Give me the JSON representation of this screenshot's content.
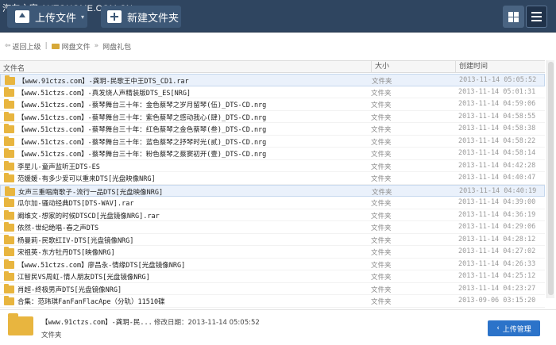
{
  "watermark": "汽车之家  AUTOHOME.COM.CN",
  "toolbar": {
    "upload_label": "上传文件",
    "upload_caret": "▾",
    "newfolder_label": "新建文件夹"
  },
  "breadcrumb": {
    "back_label": "返回上级",
    "path_root": "网盘文件",
    "separator": "»",
    "path_current": "网盘礼包"
  },
  "columns": {
    "name": "文件名",
    "size": "大小",
    "created": "创建时间"
  },
  "rows": [
    {
      "name": "【www.91ctzs.com】-龚玥-民歌王中王DTS_CD1.rar",
      "type": "文件夹",
      "date": "2013-11-14  05:05:52"
    },
    {
      "name": "【www.51ctzs.com】-真发烧人声精装版DTS_ES[NRG]",
      "type": "文件夹",
      "date": "2013-11-14  05:01:31"
    },
    {
      "name": "【www.51ctzs.com】-蔡琴舞台三十年：金色蔡琴之岁月留琴(伍)_DTS-CD.nrg",
      "type": "文件夹",
      "date": "2013-11-14  04:59:06"
    },
    {
      "name": "【www.51ctzs.com】-蔡琴舞台三十年：紫色蔡琴之感动我心(肆)_DTS-CD.nrg",
      "type": "文件夹",
      "date": "2013-11-14  04:58:55"
    },
    {
      "name": "【www.51ctzs.com】-蔡琴舞台三十年：红色蔡琴之金色蔡琴(叁)_DTS-CD.nrg",
      "type": "文件夹",
      "date": "2013-11-14  04:58:38"
    },
    {
      "name": "【www.51ctzs.com】-蔡琴舞台三十年：蓝色蔡琴之抒琴时光(贰)_DTS-CD.nrg",
      "type": "文件夹",
      "date": "2013-11-14  04:58:22"
    },
    {
      "name": "【www.51ctzs.com】-蔡琴舞台三十年：粉色蔡琴之蔡窦初开(壹)_DTS-CD.nrg",
      "type": "文件夹",
      "date": "2013-11-14  04:58:14"
    },
    {
      "name": "李星儿-童声监听王DTS-ES",
      "type": "文件夹",
      "date": "2013-11-14  04:42:28"
    },
    {
      "name": "范媛媛-有多少爱可以重来DTS[光盘映像NRG]",
      "type": "文件夹",
      "date": "2013-11-14  04:40:47"
    },
    {
      "name": "女声三重唱南歌子-流行一品DTS[光盘映像NRG]",
      "type": "文件夹",
      "date": "2013-11-14  04:40:19"
    },
    {
      "name": "瓜尔加-骚动经典DTS[DTS-WAV].rar",
      "type": "文件夹",
      "date": "2013-11-14  04:39:00"
    },
    {
      "name": "阚维文-想家的时候DTSCD[光盘镜像NRG].rar",
      "type": "文件夹",
      "date": "2013-11-14  04:36:19"
    },
    {
      "name": "依然-世纪绝唱-春之声DTS",
      "type": "文件夹",
      "date": "2013-11-14  04:29:06"
    },
    {
      "name": "杨曼莉-民歌红IV-DTS[光盘镜像NRG]",
      "type": "文件夹",
      "date": "2013-11-14  04:28:12"
    },
    {
      "name": "宋祖英-东方牡丹DTS[映像NRG]",
      "type": "文件夹",
      "date": "2013-11-14  04:27:02"
    },
    {
      "name": "【www.51ctzs.com】廖昌永-情缘DTS[光盘镜像NRG]",
      "type": "文件夹",
      "date": "2013-11-14  04:26:33"
    },
    {
      "name": "江智民VS周虹-情人朋友DTS[光盘镜像NRG]",
      "type": "文件夹",
      "date": "2013-11-14  04:25:12"
    },
    {
      "name": "肖超-终极男声DTS[光盘镜像NRG]",
      "type": "文件夹",
      "date": "2013-11-14  04:23:27"
    },
    {
      "name": "合集：范玮琪FanFanFlacApe（分轨）11510碟",
      "type": "文件夹",
      "date": "2013-09-06  03:15:20"
    }
  ],
  "footer": {
    "selected_name": "【www.91ctzs.com】-龚玥-民...",
    "modified_label": "修改日期：2013-11-14  05:05:52",
    "selected_type": "文件夹",
    "manage_label": "上传管理",
    "watermark": "汽车之家  AUTOHOME.COM.CN"
  },
  "selected_rows": [
    0,
    9
  ]
}
